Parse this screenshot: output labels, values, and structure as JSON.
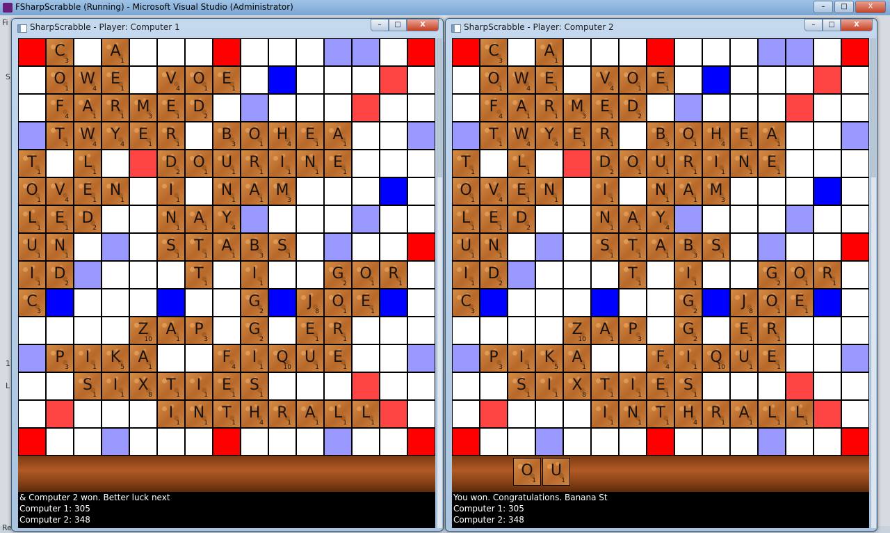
{
  "vs": {
    "title": "FSharpScrabble (Running) - Microsoft Visual Studio (Administrator)",
    "min": "–",
    "max": "□",
    "close": "X",
    "side_glyphs": [
      "Fi",
      "S",
      "1",
      "L",
      "Re"
    ]
  },
  "left_window": {
    "title": "SharpScrabble - Player: Computer 1",
    "min": "–",
    "max": "□",
    "close": "X",
    "status": [
      " & Computer 2 won.  Better luck next",
      "Computer 1: 305",
      "Computer 2: 348"
    ],
    "rack": []
  },
  "right_window": {
    "title": "SharpScrabble - Player: Computer 2",
    "min": "–",
    "max": "□",
    "close": "X",
    "status": [
      "You won.  Congratulations.  Banana St",
      "Computer 1: 305",
      "Computer 2: 348"
    ],
    "rack": [
      {
        "letter": "O",
        "value": "1"
      },
      {
        "letter": "U",
        "value": "1"
      }
    ]
  },
  "square_colors": {
    "triple_word": "#ff0000",
    "double_word": "#ff4444",
    "triple_letter": "#0000ff",
    "double_letter": "#9999ff",
    "tile": "#c47a38"
  },
  "board_squares": [
    "T.,,d,,,T,,,d,,,T",
    ",D,,,t,,,,,t,,,D,",
    ",,D,,,d,,d,,,D,,",
    "d,,D,,,d,,,D,,d",
    ",,,,D,,,,,,D,,,,",
    ",t,,,t,,,,t,,,t,",
    ",,d,,,d,,d,,,d,,",
    "T,,d,,,D,,,d,,T",
    ",,d,,,d,,d,,,d,,",
    ",t,,,t,,,,t,,,t,",
    ",,,,D,,,,,,D,,,,",
    "d,,D,,,d,,,D,,d",
    ",,D,,,d,,d,,,D,,",
    ",D,,,t,,,,,t,,,D,",
    "T,,d,,,T,,,d,,,T"
  ],
  "board_rows": [
    "T C e A e e e T e e e d e e T",
    "e O W E e V O E e t e e e D e",
    "e F A R M E D e d e e e D e e",
    "d T W Y E R e B O H E A e e d",
    "T e L e D D O U R I N E e e e",
    "O V E N e I e N A M e e e t e",
    "L E D e e N A Y d e e e d e e",
    "U N e d e S T A B S e e d e e T",
    "I D d e e e T e I e e G O R e",
    "C t e e e t e e G t J O E t e",
    "e e e e Z A P e G e E R e e e",
    "d P I K A e e F I Q U E e e d",
    "e e S I X T I E S e e e D e e",
    "e D e e e I N T H R A L L D e",
    "T e e d e e e T e e e d e e T"
  ],
  "tile_values": {
    "C": "3",
    "A": "1",
    "O": "1",
    "W": "4",
    "E": "1",
    "V": "4",
    "F": "4",
    "R": "1",
    "M": "3",
    "D": "2",
    "T": "1",
    "Y": "4",
    "B": "3",
    "H": "4",
    "L": "1",
    "U": "1",
    "I": "1",
    "N": "1",
    "S": "1",
    "G": "2",
    "J": "8",
    "Z": "10",
    "P": "3",
    "K": "5",
    "Q": "10",
    "X": "8"
  }
}
